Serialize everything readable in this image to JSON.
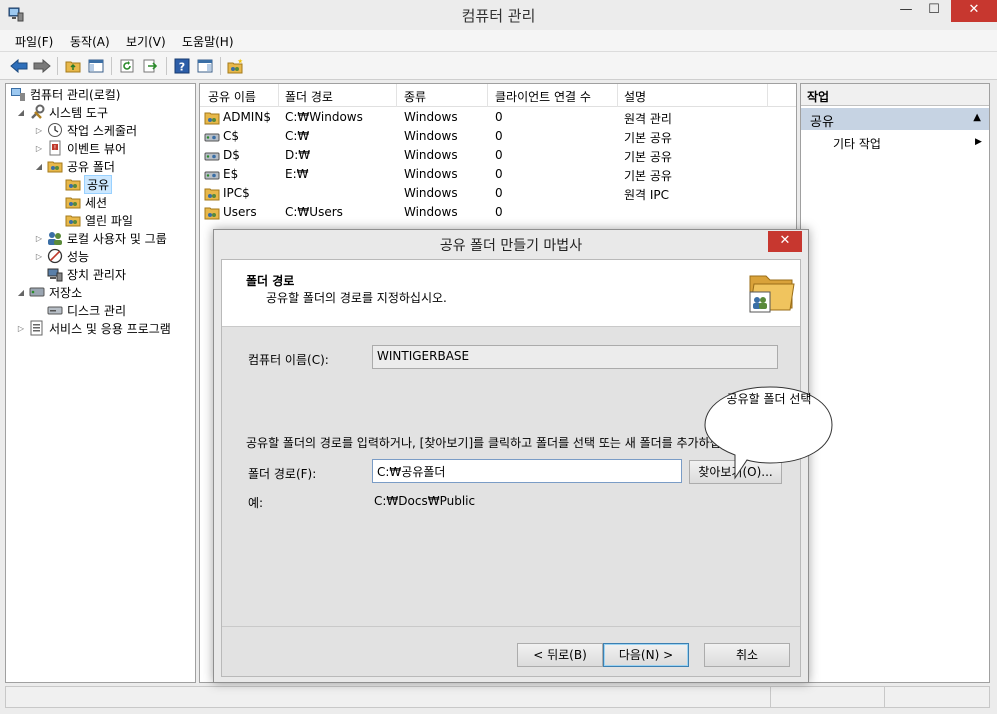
{
  "window": {
    "title": "컴퓨터 관리",
    "min_glyph": "—",
    "max_glyph": "☐",
    "close_glyph": "✕"
  },
  "menu": [
    {
      "label": "파일(F)"
    },
    {
      "label": "동작(A)"
    },
    {
      "label": "보기(V)"
    },
    {
      "label": "도움말(H)"
    }
  ],
  "toolbar": {
    "icons": [
      "back-icon",
      "forward-icon",
      "up-folder-icon",
      "show-hide-tree-icon",
      "refresh-icon",
      "export-list-icon",
      "help-icon",
      "show-hide-action-pane-icon",
      "new-share-icon"
    ]
  },
  "tree": {
    "items": [
      {
        "label": "컴퓨터 관리(로컬)"
      },
      {
        "label": "시스템 도구"
      },
      {
        "label": "작업 스케줄러"
      },
      {
        "label": "이벤트 뷰어"
      },
      {
        "label": "공유 폴더"
      },
      {
        "label": "공유"
      },
      {
        "label": "세션"
      },
      {
        "label": "열린 파일"
      },
      {
        "label": "로컬 사용자 및 그룹"
      },
      {
        "label": "성능"
      },
      {
        "label": "장치 관리자"
      },
      {
        "label": "저장소"
      },
      {
        "label": "디스크 관리"
      },
      {
        "label": "서비스 및 응용 프로그램"
      }
    ]
  },
  "shares": {
    "columns": [
      "공유 이름",
      "폴더 경로",
      "종류",
      "클라이언트 연결 수",
      "설명"
    ],
    "rows": [
      {
        "name": "ADMIN$",
        "path": "C:₩Windows",
        "type": "Windows",
        "clients": "0",
        "desc": "원격 관리"
      },
      {
        "name": "C$",
        "path": "C:₩",
        "type": "Windows",
        "clients": "0",
        "desc": "기본 공유"
      },
      {
        "name": "D$",
        "path": "D:₩",
        "type": "Windows",
        "clients": "0",
        "desc": "기본 공유"
      },
      {
        "name": "E$",
        "path": "E:₩",
        "type": "Windows",
        "clients": "0",
        "desc": "기본 공유"
      },
      {
        "name": "IPC$",
        "path": "",
        "type": "Windows",
        "clients": "0",
        "desc": "원격 IPC"
      },
      {
        "name": "Users",
        "path": "C:₩Users",
        "type": "Windows",
        "clients": "0",
        "desc": ""
      }
    ]
  },
  "actions": {
    "header": "작업",
    "section": "공유",
    "more": "기타 작업",
    "collapse_glyph": "▲",
    "more_glyph": "▶"
  },
  "wizard": {
    "title": "공유 폴더 만들기 마법사",
    "header_title": "폴더 경로",
    "header_subtitle": "공유할 폴더의 경로를 지정하십시오.",
    "computer_name_label": "컴퓨터 이름(C):",
    "computer_name_value": "WINTIGERBASE",
    "instructions": "공유할 폴더의 경로를 입력하거나, [찾아보기]를 클릭하고 폴더를 선택 또는 새 폴더를 추가하십시오.",
    "folder_path_label": "폴더 경로(F):",
    "folder_path_value": "C:₩공유폴더",
    "browse_label": "찾아보기(O)...",
    "example_label": "예:",
    "example_value": "C:₩Docs₩Public",
    "back_label": "< 뒤로(B)",
    "next_label": "다음(N) >",
    "cancel_label": "취소"
  },
  "callout": {
    "text": "공유할 폴더 선택"
  }
}
